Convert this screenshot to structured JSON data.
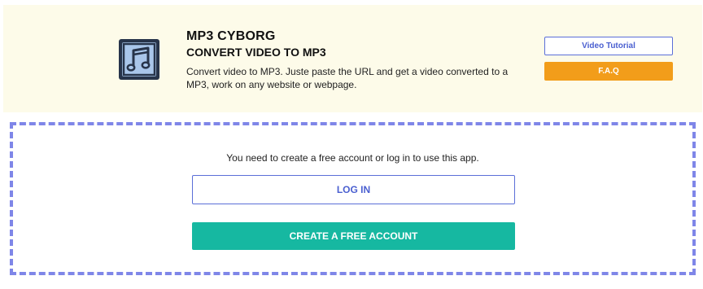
{
  "header": {
    "app_name": "MP3 CYBORG",
    "subtitle": "CONVERT VIDEO TO MP3",
    "description": "Convert video to MP3. Juste paste the URL and get a video converted to a MP3, work on any website or webpage.",
    "icon": "music-album-icon",
    "tutorial_label": "Video Tutorial",
    "faq_label": "F.A.Q"
  },
  "auth": {
    "message": "You need to create a free account or log in to use this app.",
    "login_label": "LOG IN",
    "create_label": "CREATE A FREE ACCOUNT"
  },
  "colors": {
    "header_bg": "#fdfbe9",
    "accent_blue": "#5b6fd8",
    "faq_orange": "#f29d1a",
    "create_teal": "#16b8a1",
    "dashed_border": "#7f86e8"
  }
}
